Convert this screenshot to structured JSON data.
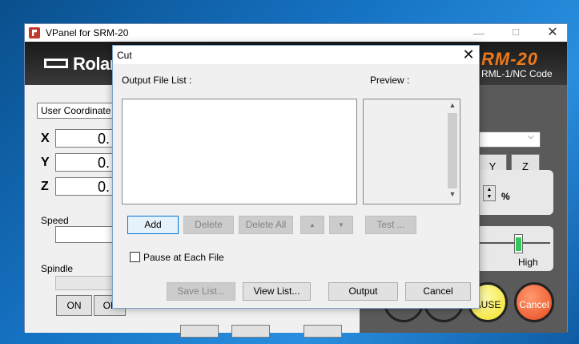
{
  "main_window": {
    "title": "VPanel for SRM-20",
    "minimize_icon": "—",
    "maximize_icon": "☐",
    "close_icon": "✕",
    "brand": "Rolan",
    "model": "RM-20",
    "model_sub": "RML-1/NC Code",
    "coord_system": "User Coordinate Sy",
    "axes": [
      {
        "label": "X",
        "value": "0."
      },
      {
        "label": "Y",
        "value": "0."
      },
      {
        "label": "Z",
        "value": "0."
      }
    ],
    "speed_label": "Speed",
    "spindle_label": "Spindle",
    "on_label": "ON",
    "off_label": "OF",
    "y_button": "Y",
    "z_button": "Z",
    "percent": "%",
    "high_label": "High",
    "pause_label": "AUSE",
    "cancel_label": "Cancel"
  },
  "cut_dialog": {
    "title": "Cut",
    "close_icon": "✕",
    "output_file_list_label": "Output File List :",
    "preview_label": "Preview :",
    "buttons": {
      "add": "Add",
      "delete": "Delete",
      "delete_all": "Delete All",
      "up": "▲",
      "down": "▼",
      "test": "Test ...",
      "save_list": "Save List...",
      "view_list": "View List...",
      "output": "Output",
      "cancel": "Cancel"
    },
    "pause_each_file_label": "Pause at Each File",
    "pause_each_file_checked": false,
    "scroll_up": "▲",
    "scroll_down": "▼"
  }
}
